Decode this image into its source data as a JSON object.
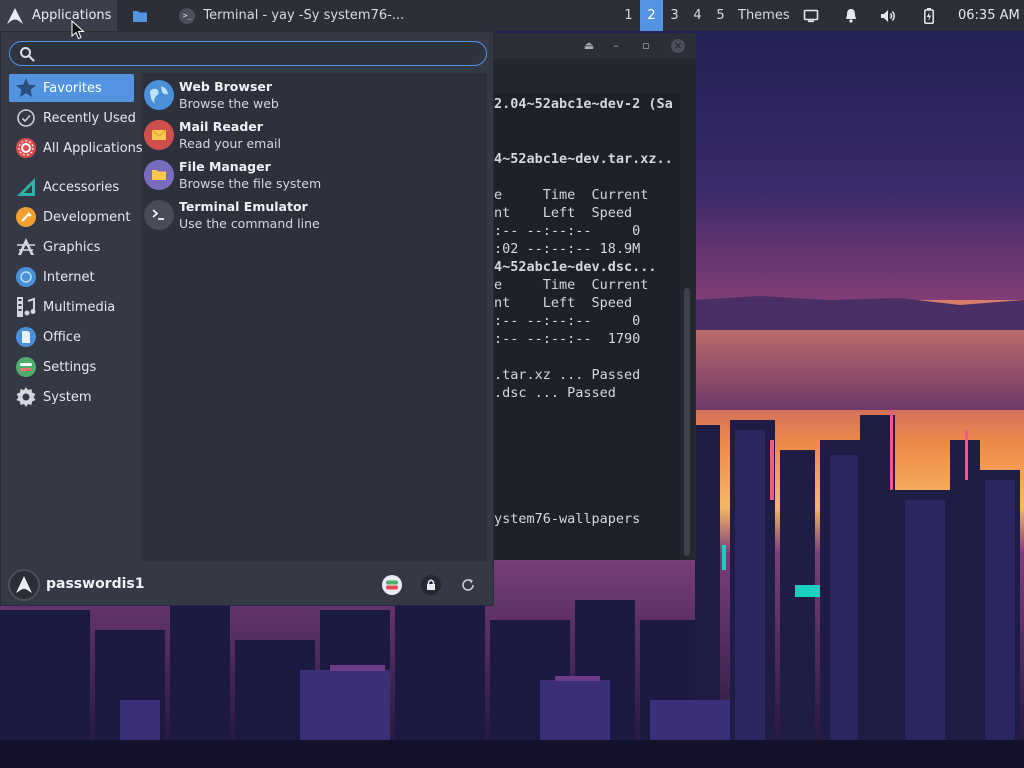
{
  "panel": {
    "applications_label": "Applications",
    "task_title": "Terminal - yay -Sy system76-...",
    "task_icon_glyph": ">_",
    "workspaces": [
      "1",
      "2",
      "3",
      "4",
      "5"
    ],
    "active_workspace": "2",
    "themes_label": "Themes",
    "clock": "06:35 AM",
    "tray_icons": [
      "display-icon",
      "notification-bell-icon",
      "volume-icon",
      "battery-icon"
    ]
  },
  "search": {
    "value": "",
    "placeholder": ""
  },
  "categories": [
    {
      "label": "Favorites",
      "icon": "star-icon",
      "selected": true
    },
    {
      "label": "Recently Used",
      "icon": "clock-icon"
    },
    {
      "label": "All Applications",
      "icon": "all-apps-icon"
    },
    {
      "label": "Accessories",
      "icon": "accessories-icon"
    },
    {
      "label": "Development",
      "icon": "development-icon"
    },
    {
      "label": "Graphics",
      "icon": "graphics-icon"
    },
    {
      "label": "Internet",
      "icon": "internet-icon"
    },
    {
      "label": "Multimedia",
      "icon": "multimedia-icon"
    },
    {
      "label": "Office",
      "icon": "office-icon"
    },
    {
      "label": "Settings",
      "icon": "settings-icon"
    },
    {
      "label": "System",
      "icon": "system-gear-icon"
    }
  ],
  "apps": [
    {
      "name": "Web Browser",
      "desc": "Browse the web",
      "icon": "globe-icon"
    },
    {
      "name": "Mail Reader",
      "desc": "Read your email",
      "icon": "mail-icon"
    },
    {
      "name": "File Manager",
      "desc": "Browse the file system",
      "icon": "folder-icon"
    },
    {
      "name": "Terminal Emulator",
      "desc": "Use the command line",
      "icon": "terminal-icon"
    }
  ],
  "user": {
    "name": "passwordis1"
  },
  "terminal": {
    "lines": [
      {
        "text": "2.04~52abc1e~dev-2 (Sa",
        "bold": true
      },
      {
        "text": "4~52abc1e~dev.tar.xz..",
        "bold": true
      },
      {
        "text": "e     Time  Current",
        "bold": false
      },
      {
        "text": "nt    Left  Speed",
        "bold": false
      },
      {
        "text": ":-- --:--:--     0",
        "bold": false
      },
      {
        "text": ":02 --:--:-- 18.9M",
        "bold": false
      },
      {
        "text": "4~52abc1e~dev.dsc...",
        "bold": true
      },
      {
        "text": "e     Time  Current",
        "bold": false
      },
      {
        "text": "nt    Left  Speed",
        "bold": false
      },
      {
        "text": ":-- --:--:--     0",
        "bold": false
      },
      {
        "text": ":-- --:--:--  1790",
        "bold": false
      },
      {
        "text": ".tar.xz ... Passed",
        "bold": false
      },
      {
        "text": ".dsc ... Passed",
        "bold": false
      },
      {
        "text": "ystem76-wallpapers",
        "bold": false
      }
    ]
  },
  "colors": {
    "accent": "#5294e2",
    "panel": "#2b2f37",
    "menu_bg": "#353945",
    "apps_bg": "#2d313b"
  }
}
